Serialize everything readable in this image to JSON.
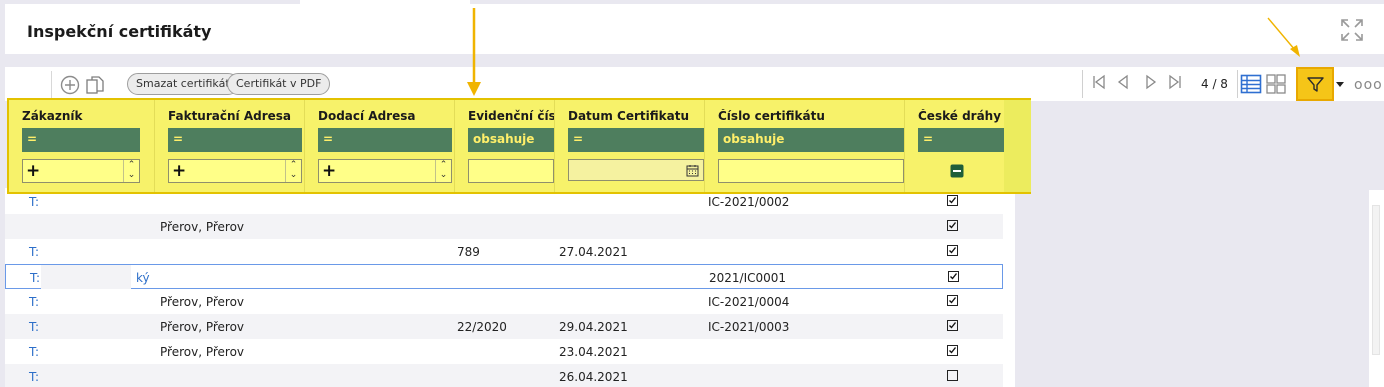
{
  "window": {
    "title": "Inspekční certifikáty"
  },
  "toolbar": {
    "buttons": [
      "Smazat certifikát",
      "Certifikát v PDF"
    ],
    "page_count": "4 / 8",
    "more": "ooo"
  },
  "filter_panel": {
    "columns": [
      {
        "header": "Zákazník",
        "operator": "=",
        "input": ""
      },
      {
        "header": "Fakturační Adresa",
        "operator": "=",
        "input": ""
      },
      {
        "header": "Dodací Adresa",
        "operator": "=",
        "input": ""
      },
      {
        "header": "Evidenční čís...",
        "operator": "obsahuje",
        "input": ""
      },
      {
        "header": "Datum Certifikatu",
        "operator": "=",
        "input": ""
      },
      {
        "header": "Číslo certifikátu",
        "operator": "obsahuje",
        "input": ""
      },
      {
        "header": "České dráhy",
        "operator": "=",
        "input": ""
      }
    ]
  },
  "grid": {
    "rows": [
      {
        "t": "T:",
        "zakaznik": "",
        "fakturacni": "",
        "evidencni": "",
        "datum": "",
        "cislo": "IC-2021/0002",
        "ceske": true
      },
      {
        "t": "",
        "zakaznik": "",
        "fakturacni": "Přerov, Přerov",
        "evidencni": "",
        "datum": "",
        "cislo": "",
        "ceske": true
      },
      {
        "t": "T:",
        "zakaznik": "",
        "fakturacni": "",
        "evidencni": "789",
        "datum": "27.04.2021",
        "cislo": "",
        "ceske": true
      },
      {
        "t": "T:",
        "zakaznik": "ký",
        "fakturacni": "",
        "evidencni": "",
        "datum": "",
        "cislo": "2021/IC0001",
        "ceske": true
      },
      {
        "t": "T:",
        "zakaznik": "",
        "fakturacni": "Přerov, Přerov",
        "evidencni": "",
        "datum": "",
        "cislo": "IC-2021/0004",
        "ceske": true
      },
      {
        "t": "T:",
        "zakaznik": "",
        "fakturacni": "Přerov, Přerov",
        "evidencni": "22/2020",
        "datum": "29.04.2021",
        "cislo": "IC-2021/0003",
        "ceske": true
      },
      {
        "t": "T:",
        "zakaznik": "",
        "fakturacni": "Přerov, Přerov",
        "evidencni": "",
        "datum": "23.04.2021",
        "cislo": "",
        "ceske": true
      },
      {
        "t": "T:",
        "zakaznik": "",
        "fakturacni": "",
        "evidencni": "",
        "datum": "26.04.2021",
        "cislo": "",
        "ceske": false
      }
    ]
  },
  "colors": {
    "accent_arrow": "#f0b400",
    "filter_panel_bg": "#f7f26a",
    "operator_bg": "#4e7e5e",
    "operator_text": "#ffef6a",
    "link_blue": "#2d6fc9",
    "filter_button": "#f5c518"
  },
  "icons": [
    "expand-icon",
    "add-circle-icon",
    "copy-icon",
    "first-page-icon",
    "prev-page-icon",
    "next-page-icon",
    "last-page-icon",
    "list-view-icon",
    "tile-view-icon",
    "filter-icon",
    "calendar-icon",
    "minus-icon"
  ]
}
